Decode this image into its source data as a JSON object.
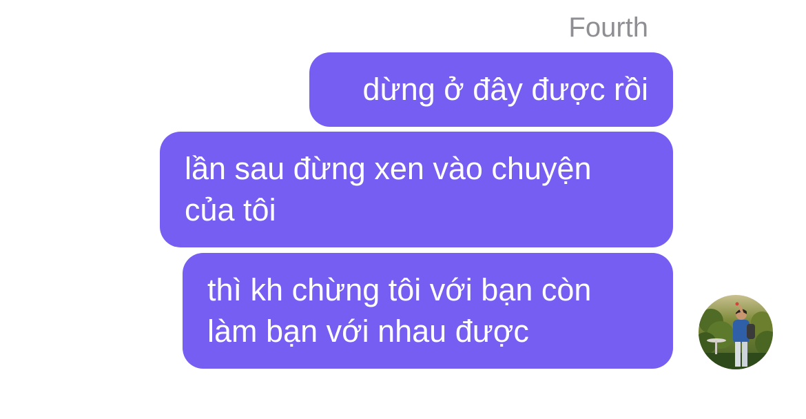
{
  "chat": {
    "sender_name": "Fourth",
    "bubble_color": "#765ef3",
    "messages": [
      {
        "lines": [
          "dừng ở đây được rồi"
        ]
      },
      {
        "lines": [
          "lần sau đừng xen vào chuyện",
          "của tôi"
        ]
      },
      {
        "lines": [
          "thì kh chừng tôi với bạn còn",
          "làm bạn với nhau được"
        ]
      }
    ],
    "avatar": {
      "icon": "user-photo-avatar"
    }
  }
}
